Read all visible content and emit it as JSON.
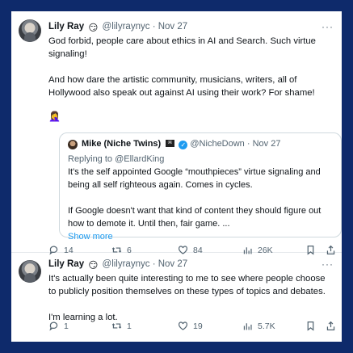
{
  "tweets": [
    {
      "name": "Lily Ray",
      "emoji": "😏",
      "handle": "@lilyraynyc",
      "date": "Nov 27",
      "more": "···",
      "lines": [
        "God forbid, people care about ethics in AI and Search. Such virtue signaling!",
        "And how dare the artistic community, musicians, writers, all of Hollywood also speak out against AI using their work? For shame!"
      ],
      "trailing_emoji": "🤦‍♀️",
      "quote": {
        "name": "Mike (Niche Twins)",
        "flag_icon": "pirate-flag-icon",
        "handle": "@NicheDown",
        "date": "Nov 27",
        "replying_prefix": "Replying to ",
        "replying_to": "@EllardKing",
        "lines": [
          "It's the self appointed Google “mouthpieces” virtue signaling and being all self righteous again. Comes in cycles.",
          "If Google doesn't want that kind of content they should figure out how to demote it. Until then, fair game. ..."
        ],
        "show_more": "Show more"
      },
      "actions": {
        "replies": "14",
        "retweets": "6",
        "likes": "84",
        "views": "26K"
      }
    },
    {
      "name": "Lily Ray",
      "emoji": "😏",
      "handle": "@lilyraynyc",
      "date": "Nov 27",
      "more": "···",
      "lines": [
        "It's actually been quite interesting to me to see where people choose to publicly position themselves on these types of topics and debates.",
        "I'm learning a lot."
      ],
      "actions": {
        "replies": "1",
        "retweets": "1",
        "likes": "19",
        "views": "5.7K"
      }
    }
  ],
  "colors": {
    "background": "#0e2a6b",
    "card": "#ffffff",
    "link": "#1d9bf0",
    "secondary_text": "#536471"
  }
}
